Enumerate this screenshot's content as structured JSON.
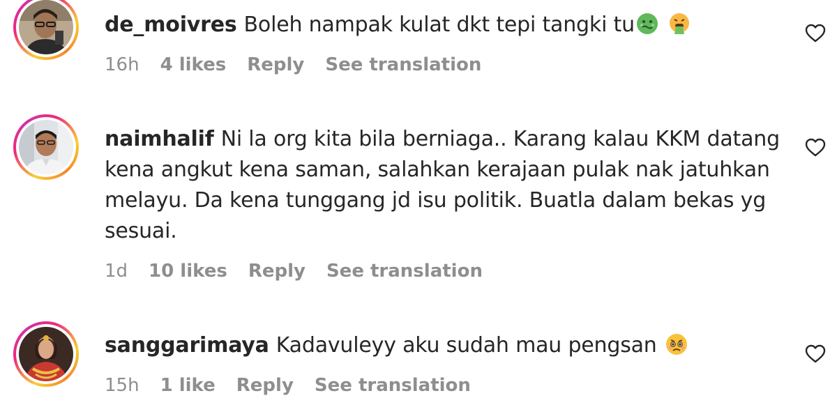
{
  "comments": [
    {
      "username": "de_moivres",
      "text": "Boleh nampak kulat dkt tepi tangki tu",
      "emojis": [
        "nauseated-face-emoji",
        "face-vomiting-emoji"
      ],
      "time": "16h",
      "likes": "4 likes",
      "reply_label": "Reply",
      "translate_label": "See translation",
      "avatar_icon": "user-photo-man-glasses"
    },
    {
      "username": "naimhalif",
      "text": "Ni la org kita bila berniaga.. Karang kalau KKM datang kena angkut kena saman, salahkan kerajaan pulak nak jatuhkan melayu. Da kena tunggang jd isu politik. Buatla dalam bekas yg sesuai.",
      "emojis": [],
      "time": "1d",
      "likes": "10 likes",
      "reply_label": "Reply",
      "translate_label": "See translation",
      "avatar_icon": "user-photo-man-office"
    },
    {
      "username": "sanggarimaya",
      "text": "Kadavuleyy aku sudah mau pengsan",
      "emojis": [
        "worried-face-emoji"
      ],
      "time": "15h",
      "likes": "1 like",
      "reply_label": "Reply",
      "translate_label": "See translation",
      "avatar_icon": "user-photo-bride"
    }
  ],
  "colors": {
    "text": "#262626",
    "meta": "#8e8e8e",
    "ring_start": "#f9ce34",
    "ring_mid": "#ee2a7b",
    "ring_end": "#6228d7"
  },
  "icons": {
    "like": "heart-outline-icon"
  }
}
